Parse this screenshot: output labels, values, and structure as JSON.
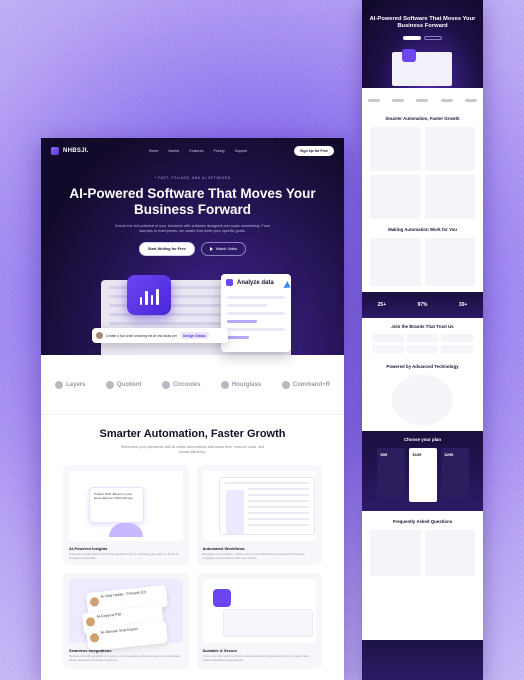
{
  "main": {
    "nav": {
      "brand": "NHBSJI.",
      "links": [
        "Home",
        "Market",
        "Features",
        "Pricing",
        "Support"
      ],
      "cta": "Sign Up for Free"
    },
    "hero": {
      "tag": "+ FAST, FOLIAGE, AND AI-OPTIMIZED",
      "title": "AI-Powered Software That Moves Your Business Forward",
      "subtitle": "Unlock the full potential of your business with software designed and scale seamlessly. From startups to enterprises, we create that meet your specific goals.",
      "primary_cta": "Start Writing for Free",
      "secondary_cta": "Watch Video",
      "analyze_label": "Analyze data",
      "prompt_text": "Create a bar chart showing the at risk tasks per",
      "prompt_chip": "Design Status"
    },
    "logos": [
      "Layers",
      "Quotient",
      "Circooles",
      "Hourglass",
      "Command+R"
    ],
    "features": {
      "title": "Smarter Automation, Faster Growth",
      "subtitle": "Streamline your operations with AI-driven automations that saves time, reduces costs, and boosts efficiency.",
      "cards": [
        {
          "title": "AI-Powered Insights",
          "desc": "Automate routine tasks so that up valuable time for elevating your team to focus on strategy and growth."
        },
        {
          "title": "Automated Workflows",
          "desc": "Eliminate manual effort, reduce errors and streamline processes so that keep engaged and consistent with your brand."
        },
        {
          "title": "Seamless Integrations",
          "desc": "Reduce in-depth analytics to improve your campaigns effectiveness and make data-driven decisions for better outcomes."
        },
        {
          "title": "Scalable & Secure",
          "desc": "Grow your effortlessly with the tools enterprise that grow with your company and ... unified scheduling integrations."
        }
      ],
      "bubble_text": "Today’s Brief: Based on your latest data the CRM Lifecycle",
      "tilt_names": [
        "Ai Chat Habits - Pinnacle Ed",
        "AI-Copycat Pair",
        "AI Ultimate Seat Expert"
      ]
    }
  },
  "side": {
    "hero_title": "AI-Powered Software That Moves Your Business Forward",
    "sections": [
      "Smarter Automation, Faster Growth",
      "Making Automation Work for You",
      "Join the Brands That Trust Us",
      "Powered by Advanced Technology",
      "Choose your plan",
      "Frequently Asked Questions"
    ],
    "stats": [
      "25+",
      "97%",
      "30+"
    ],
    "prices": [
      "$99",
      "$199",
      "$299"
    ]
  },
  "colors": {
    "accent": "#6b46f2",
    "hero_dark": "#120a2a",
    "background": "#8a6ef0"
  }
}
